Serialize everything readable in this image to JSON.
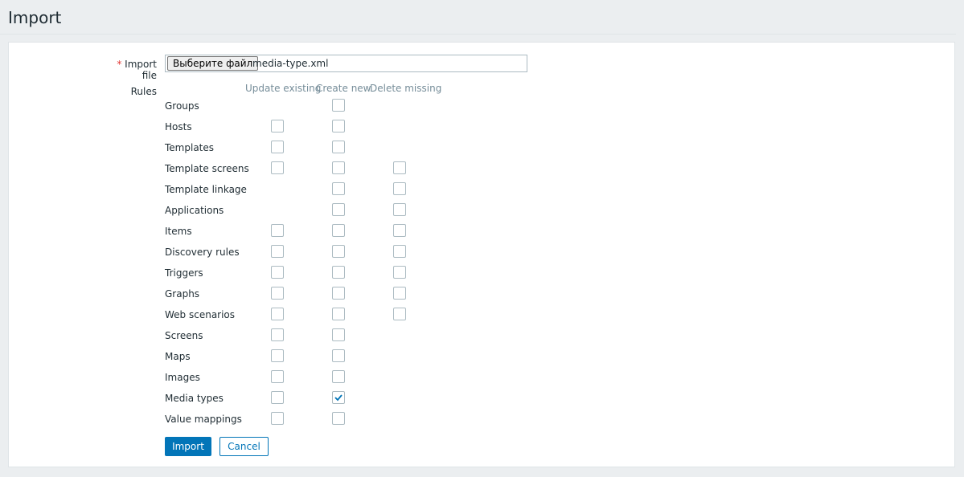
{
  "page": {
    "title": "Import"
  },
  "form": {
    "import_file": {
      "required_mark": "*",
      "label": "Import file",
      "button_label": "Выберите файл",
      "file_name": "media-type.xml"
    },
    "rules_label": "Rules",
    "columns": [
      "Update existing",
      "Create new",
      "Delete missing"
    ],
    "rules": [
      {
        "label": "Groups",
        "update_existing": null,
        "create_new": false,
        "delete_missing": null
      },
      {
        "label": "Hosts",
        "update_existing": false,
        "create_new": false,
        "delete_missing": null
      },
      {
        "label": "Templates",
        "update_existing": false,
        "create_new": false,
        "delete_missing": null
      },
      {
        "label": "Template screens",
        "update_existing": false,
        "create_new": false,
        "delete_missing": false
      },
      {
        "label": "Template linkage",
        "update_existing": null,
        "create_new": false,
        "delete_missing": false
      },
      {
        "label": "Applications",
        "update_existing": null,
        "create_new": false,
        "delete_missing": false
      },
      {
        "label": "Items",
        "update_existing": false,
        "create_new": false,
        "delete_missing": false
      },
      {
        "label": "Discovery rules",
        "update_existing": false,
        "create_new": false,
        "delete_missing": false
      },
      {
        "label": "Triggers",
        "update_existing": false,
        "create_new": false,
        "delete_missing": false
      },
      {
        "label": "Graphs",
        "update_existing": false,
        "create_new": false,
        "delete_missing": false
      },
      {
        "label": "Web scenarios",
        "update_existing": false,
        "create_new": false,
        "delete_missing": false
      },
      {
        "label": "Screens",
        "update_existing": false,
        "create_new": false,
        "delete_missing": null
      },
      {
        "label": "Maps",
        "update_existing": false,
        "create_new": false,
        "delete_missing": null
      },
      {
        "label": "Images",
        "update_existing": false,
        "create_new": false,
        "delete_missing": null
      },
      {
        "label": "Media types",
        "update_existing": false,
        "create_new": true,
        "delete_missing": null
      },
      {
        "label": "Value mappings",
        "update_existing": false,
        "create_new": false,
        "delete_missing": null
      }
    ],
    "buttons": {
      "import": "Import",
      "cancel": "Cancel"
    }
  },
  "colors": {
    "accent": "#0275b8",
    "required": "#e33734",
    "checkbox_border": "#acbbc2"
  }
}
